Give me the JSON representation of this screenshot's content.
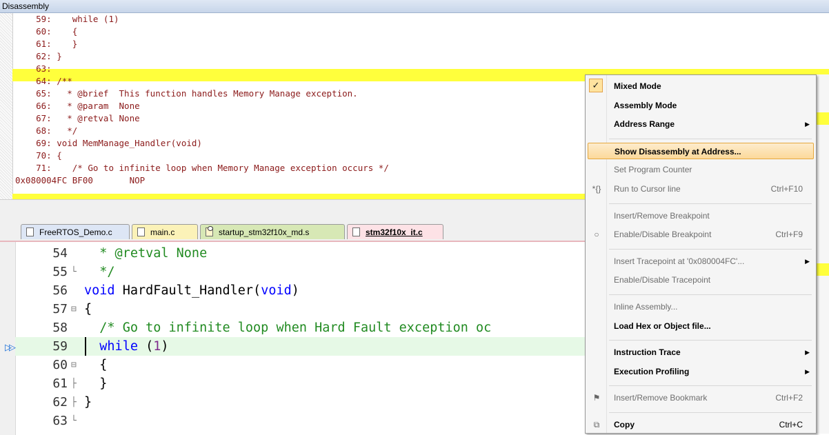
{
  "window": {
    "title": "Disassembly"
  },
  "disassembly": {
    "lines": [
      "    59:    while (1)",
      "    60:    {",
      "    61:    }",
      "    62: }",
      "    63: ",
      "    64: /**",
      "    65:   * @brief  This function handles Memory Manage exception.",
      "    66:   * @param  None",
      "    67:   * @retval None",
      "    68:   */",
      "    69: void MemManage_Handler(void)",
      "    70: {",
      "    71:    /* Go to infinite loop when Memory Manage exception occurs */",
      "0x080004FC BF00       NOP"
    ]
  },
  "tabs": [
    {
      "label": "FreeRTOS_Demo.c",
      "color": "#dde6f5"
    },
    {
      "label": "main.c",
      "color": "#fbf2b8"
    },
    {
      "label": "startup_stm32f10x_md.s",
      "color": "#d7e8b5"
    },
    {
      "label": "stm32f10x_it.c",
      "color": "#fde2e6"
    }
  ],
  "editor": {
    "lines": [
      {
        "num": "54",
        "fold": "",
        "code": "  * @retval None",
        "kind": "comment"
      },
      {
        "num": "55",
        "fold": "└",
        "code": "  */",
        "kind": "comment"
      },
      {
        "num": "56",
        "fold": "",
        "pre": "void",
        "post": " HardFault_Handler(",
        "kw2": "void",
        "tail": ")",
        "kind": "sig"
      },
      {
        "num": "57",
        "fold": "⊟",
        "code": "{",
        "kind": "plain"
      },
      {
        "num": "58",
        "fold": "",
        "code": "  /* Go to infinite loop when Hard Fault exception oc",
        "kind": "comment"
      },
      {
        "num": "59",
        "fold": "",
        "kw": "while",
        "mid": " (",
        "n": "1",
        "tail": ")",
        "kind": "while"
      },
      {
        "num": "60",
        "fold": "⊟",
        "code": "  {",
        "kind": "plain"
      },
      {
        "num": "61",
        "fold": "├",
        "code": "  }",
        "kind": "plain"
      },
      {
        "num": "62",
        "fold": "├",
        "code": "}",
        "kind": "plain"
      },
      {
        "num": "63",
        "fold": "└",
        "code": "",
        "kind": "plain"
      }
    ],
    "current_line_marker": "▷▷"
  },
  "menu": {
    "items": [
      {
        "label": "Mixed Mode",
        "checked": true,
        "bold": true
      },
      {
        "label": "Assembly Mode",
        "bold": true
      },
      {
        "label": "Address Range",
        "bold": true,
        "submenu": true
      },
      {
        "sep": true
      },
      {
        "label": "Show Disassembly at Address...",
        "bold": true,
        "hot": true
      },
      {
        "label": "Set Program Counter",
        "disabled": true
      },
      {
        "label": "Run to Cursor line",
        "shortcut": "Ctrl+F10",
        "disabled": true,
        "icon": "run-to-cursor-icon",
        "glyph": "*{}"
      },
      {
        "sep": true
      },
      {
        "label": "Insert/Remove Breakpoint",
        "disabled": true
      },
      {
        "label": "Enable/Disable Breakpoint",
        "shortcut": "Ctrl+F9",
        "disabled": true,
        "icon": "breakpoint-circle-icon",
        "glyph": "○"
      },
      {
        "sep": true
      },
      {
        "label": "Insert Tracepoint at '0x080004FC'...",
        "disabled": true,
        "submenu": true
      },
      {
        "label": "Enable/Disable Tracepoint",
        "disabled": true
      },
      {
        "sep": true
      },
      {
        "label": "Inline Assembly...",
        "disabled": true
      },
      {
        "label": "Load Hex or Object file...",
        "bold": true
      },
      {
        "sep": true
      },
      {
        "label": "Instruction Trace",
        "bold": true,
        "submenu": true
      },
      {
        "label": "Execution Profiling",
        "bold": true,
        "submenu": true
      },
      {
        "sep": true
      },
      {
        "label": "Insert/Remove Bookmark",
        "shortcut": "Ctrl+F2",
        "disabled": true,
        "icon": "bookmark-flag-icon",
        "glyph": "⚑"
      },
      {
        "sep": true
      },
      {
        "label": "Copy",
        "shortcut": "Ctrl+C",
        "bold": true,
        "icon": "copy-icon",
        "glyph": "⧉"
      }
    ]
  }
}
